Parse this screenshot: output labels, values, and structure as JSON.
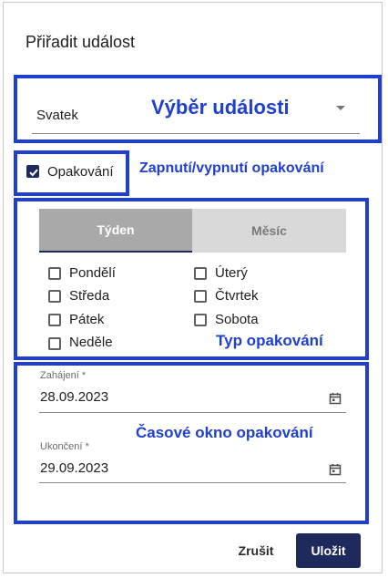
{
  "dialog": {
    "title": "Přiřadit událost"
  },
  "event_select": {
    "value": "Svatek",
    "annotation": "Výběr události"
  },
  "repeat_toggle": {
    "label": "Opakování",
    "checked": true,
    "annotation": "Zapnutí/vypnutí opakování"
  },
  "repeat_type": {
    "tabs": [
      {
        "label": "Týden",
        "active": true
      },
      {
        "label": "Měsíc",
        "active": false
      }
    ],
    "days": [
      {
        "label": "Pondělí",
        "checked": false
      },
      {
        "label": "Úterý",
        "checked": false
      },
      {
        "label": "Středa",
        "checked": false
      },
      {
        "label": "Čtvrtek",
        "checked": false
      },
      {
        "label": "Pátek",
        "checked": false
      },
      {
        "label": "Sobota",
        "checked": false
      },
      {
        "label": "Neděle",
        "checked": false
      }
    ],
    "annotation": "Typ opakování"
  },
  "time_window": {
    "start": {
      "label": "Zahájení *",
      "value": "28.09.2023"
    },
    "end": {
      "label": "Ukončení *",
      "value": "29.09.2023"
    },
    "annotation": "Časové okno opakování"
  },
  "actions": {
    "cancel": "Zrušit",
    "save": "Uložit"
  },
  "colors": {
    "annotation": "#1f3fd1",
    "primary": "#1f2a5c",
    "tab_active_bg": "#a9a9a9",
    "tab_inactive_bg": "#d9d9d9"
  },
  "icons": {
    "dropdown": "arrow-drop-down-icon",
    "date": "calendar-icon",
    "check": "check-icon"
  }
}
